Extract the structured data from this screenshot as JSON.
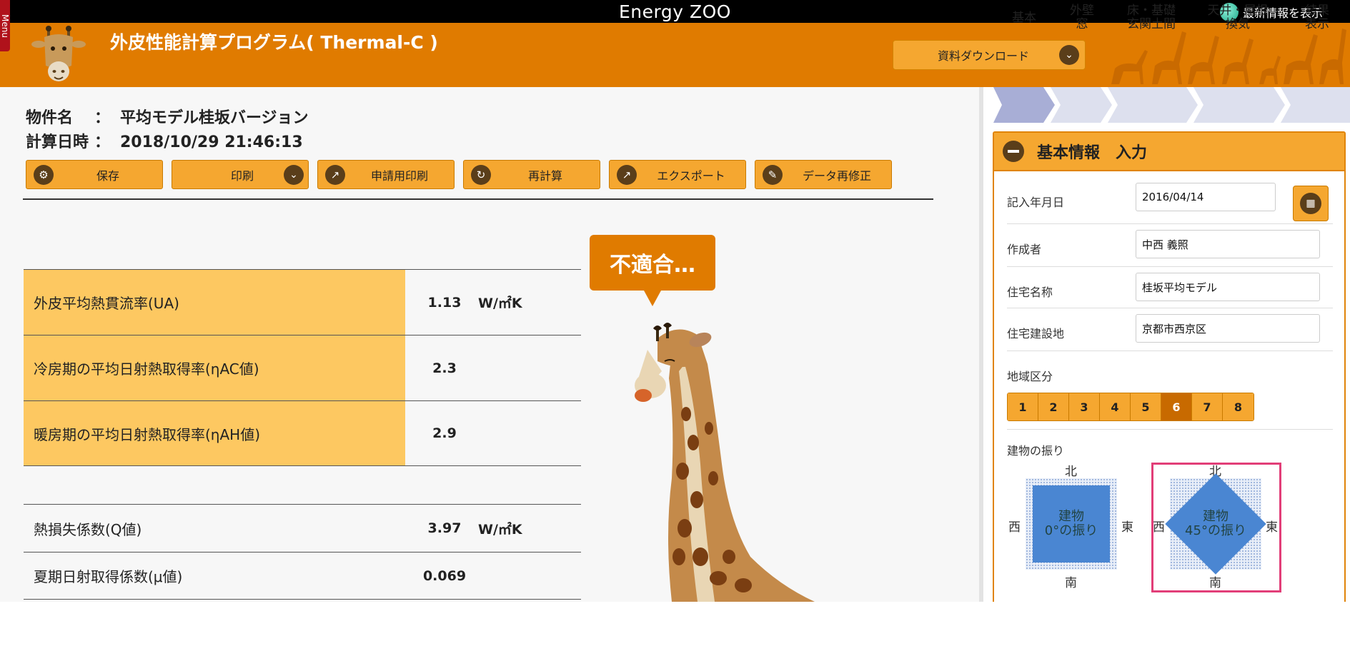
{
  "topbar": {
    "brand": "Energy ZOO",
    "news_label": "最新情報を表示",
    "menu_label": "Menu"
  },
  "header": {
    "title": "外皮性能計算プログラム( Thermal-C )",
    "download_label": "資料ダウンロード"
  },
  "project": {
    "name_key": "物件名",
    "name_sep": "：",
    "name_value": "平均モデル桂坂バージョン",
    "date_key": "計算日時",
    "date_sep": "：",
    "date_value": "2018/10/29 21:46:13"
  },
  "toolbar": {
    "save": "保存",
    "print": "印刷",
    "apply_print": "申請用印刷",
    "recalc": "再計算",
    "export": "エクスポート",
    "edit": "データ再修正"
  },
  "results": [
    {
      "label": "外皮平均熱貫流率(UA)",
      "value": "1.13",
      "unit": "W/㎡K"
    },
    {
      "label": "冷房期の平均日射熱取得率(ηAC値)",
      "value": "2.3",
      "unit": ""
    },
    {
      "label": "暖房期の平均日射熱取得率(ηAH値)",
      "value": "2.9",
      "unit": ""
    }
  ],
  "results2": [
    {
      "label": "熱損失係数(Q値)",
      "value": "3.97",
      "unit": "W/㎡K"
    },
    {
      "label": "夏期日射取得係数(μ値)",
      "value": "0.069",
      "unit": ""
    }
  ],
  "bubble": "不適合…",
  "steps": [
    {
      "line1": "基本",
      "line2": ""
    },
    {
      "line1": "外壁",
      "line2": "窓"
    },
    {
      "line1": "床・基礎",
      "line2": "玄関土間"
    },
    {
      "line1": "天井・屋根",
      "line2": "換気"
    },
    {
      "line1": "結果",
      "line2": "表示"
    }
  ],
  "panel": {
    "title": "基本情報　入力",
    "date_label": "記入年月日",
    "date_value": "2016/04/14",
    "author_label": "作成者",
    "author_value": "中西 義照",
    "house_label": "住宅名称",
    "house_value": "桂坂平均モデル",
    "site_label": "住宅建設地",
    "site_value": "京都市西京区",
    "region_label": "地域区分",
    "regions": [
      "1",
      "2",
      "3",
      "4",
      "5",
      "6",
      "7",
      "8"
    ],
    "region_selected": "6",
    "orientation_label": "建物の振り",
    "directions": {
      "north": "北",
      "south": "南",
      "west": "西",
      "east": "東"
    },
    "orient0_line1": "建物",
    "orient0_line2": "0°の振り",
    "orient45_line1": "建物",
    "orient45_line2": "45°の振り",
    "orientation_selected": "45°"
  },
  "colors": {
    "header_orange": "#e07b00",
    "button_orange": "#f5a730",
    "table_yellow": "#fdc861",
    "selection_pink": "#e23e78",
    "building_blue": "#4a86d2"
  }
}
